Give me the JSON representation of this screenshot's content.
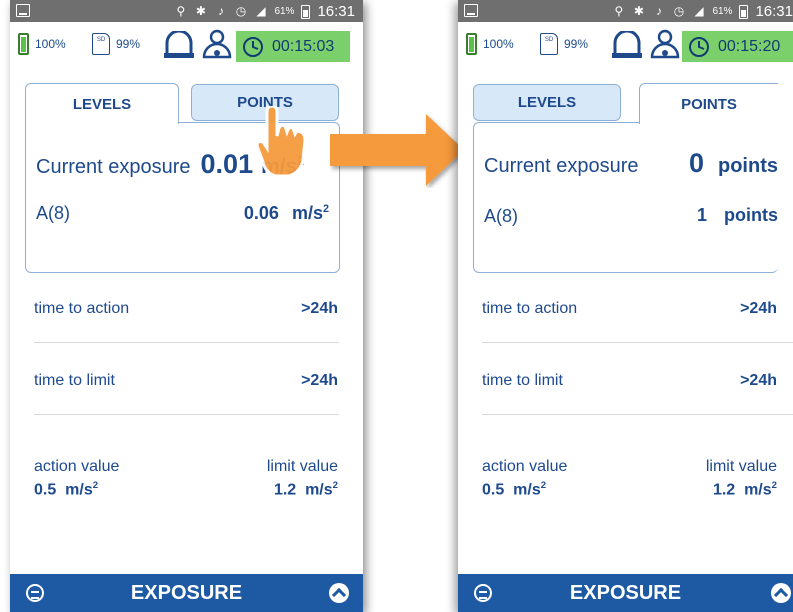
{
  "left_screen": {
    "statusbar": {
      "battery_pct": "61%",
      "time": "16:31"
    },
    "toolbar": {
      "battery": "100%",
      "sd": "99%",
      "sd_label": "SD",
      "timer": "00:15:03"
    },
    "tabs": {
      "levels": "LEVELS",
      "points": "POINTS",
      "active": "levels"
    },
    "current_exposure": {
      "label": "Current exposure",
      "value": "0.01",
      "unit": "m/s",
      "unit_exp": "2"
    },
    "a8": {
      "label": "A(8)",
      "value": "0.06",
      "unit": "m/s",
      "unit_exp": "2"
    },
    "time_to_action": {
      "label": "time to action",
      "value": ">24h"
    },
    "time_to_limit": {
      "label": "time to limit",
      "value": ">24h"
    },
    "action_value": {
      "label": "action value",
      "value": "0.5",
      "unit": "m/s",
      "unit_exp": "2"
    },
    "limit_value": {
      "label": "limit value",
      "value": "1.2",
      "unit": "m/s",
      "unit_exp": "2"
    },
    "bottom": {
      "title": "EXPOSURE"
    }
  },
  "right_screen": {
    "statusbar": {
      "battery_pct": "61%",
      "time": "16:31"
    },
    "toolbar": {
      "battery": "100%",
      "sd": "99%",
      "sd_label": "SD",
      "timer": "00:15:20"
    },
    "tabs": {
      "levels": "LEVELS",
      "points": "POINTS",
      "active": "points"
    },
    "current_exposure": {
      "label": "Current exposure",
      "value": "0",
      "unit": "points"
    },
    "a8": {
      "label": "A(8)",
      "value": "1",
      "unit": "points"
    },
    "time_to_action": {
      "label": "time to action",
      "value": ">24h"
    },
    "time_to_limit": {
      "label": "time to limit",
      "value": ">24h"
    },
    "action_value": {
      "label": "action value",
      "value": "0.5",
      "unit": "m/s",
      "unit_exp": "2"
    },
    "limit_value": {
      "label": "limit value",
      "value": "1.2",
      "unit": "m/s",
      "unit_exp": "2"
    },
    "bottom": {
      "title": "EXPOSURE"
    }
  },
  "colors": {
    "brand_blue": "#1e5aa3",
    "text_blue": "#1e4a8c",
    "timer_green": "#7cd06b",
    "arrow_orange": "#f59a3e"
  }
}
